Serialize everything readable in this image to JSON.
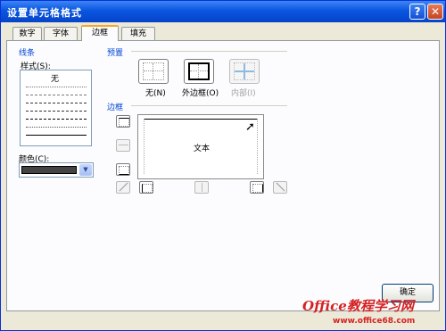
{
  "title": "设置单元格格式",
  "tabs": [
    {
      "label": "数字",
      "active": false
    },
    {
      "label": "字体",
      "active": false
    },
    {
      "label": "边框",
      "active": true
    },
    {
      "label": "填充",
      "active": false
    }
  ],
  "line": {
    "group_label": "线条",
    "style_label": "样式(S):",
    "none_label": "无",
    "color_label": "颜色(C):",
    "color_value": "#444444"
  },
  "presets": {
    "group_label": "预置",
    "items": [
      {
        "label": "无(N)",
        "enabled": true
      },
      {
        "label": "外边框(O)",
        "enabled": true
      },
      {
        "label": "内部(I)",
        "enabled": false
      }
    ]
  },
  "border": {
    "group_label": "边框",
    "preview_text": "文本"
  },
  "ok_label": "确定",
  "watermark": {
    "text": "Office教程学习网",
    "sub": "www.office68.com"
  },
  "colors": {
    "title_bar": "#0a56e0",
    "group_label": "#0046d5",
    "tab_highlight": "#f5a624",
    "watermark": "#d42222"
  }
}
